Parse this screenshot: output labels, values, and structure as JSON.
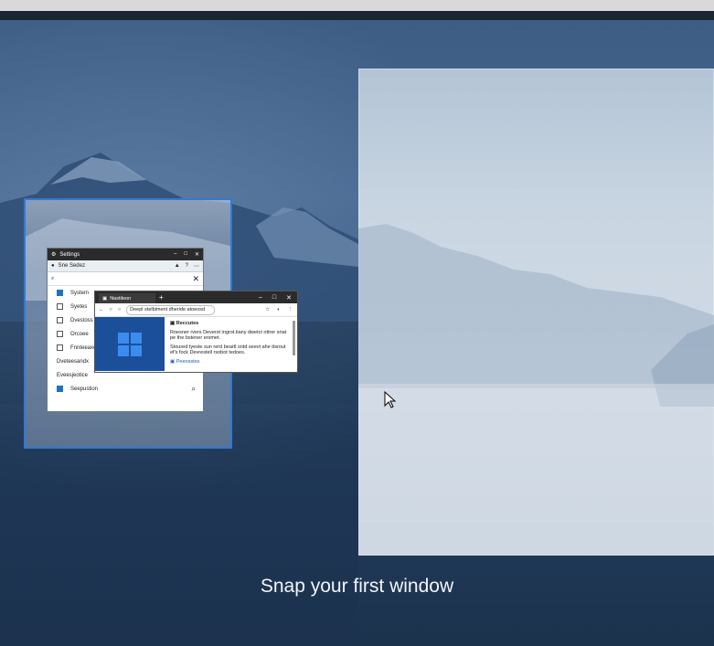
{
  "caption": "Snap your first window",
  "settings_window": {
    "title": "Settings",
    "bar_label": "Sne  Sedez",
    "items": [
      {
        "label": "System",
        "icon": "monitor-icon"
      },
      {
        "label": "Syetes",
        "icon": "bluetooth-icon"
      },
      {
        "label": "Dvestoss",
        "icon": "devices-icon"
      },
      {
        "label": "Orcoee",
        "icon": "network-icon"
      },
      {
        "label": "Fnnteeaxels",
        "icon": "personalization-icon"
      },
      {
        "label": "Dveteesandx",
        "icon": ""
      },
      {
        "label": "Eveesjeotice",
        "icon": ""
      },
      {
        "label": "Seepustion",
        "icon": "shield-icon"
      }
    ]
  },
  "browser_window": {
    "tab_label": "Nastileon",
    "url": "Deepl stelbiment dheride atoeosd",
    "heading": "Reccutes",
    "para1": "Roesner rvers Deverst ingrot.tiany dwetct ottrer sriat pe the bstener ersmet.",
    "para2": "Stoured tyeste sun rerd beartl sntd seevt ahe ttsrout ef's fock Devrestell rsobot tedoes.",
    "link": "Peeosstes"
  },
  "colors": {
    "snap_border": "#2f7ad6",
    "windows_blue": "#1b4f9a"
  }
}
